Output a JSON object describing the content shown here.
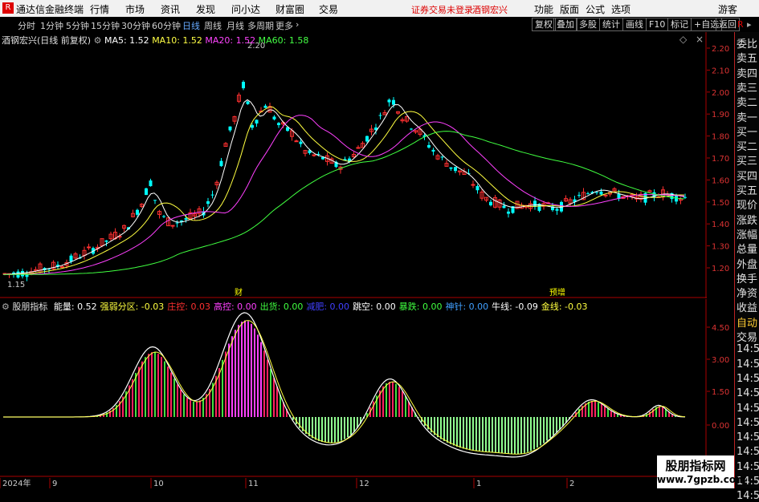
{
  "menubar": {
    "app_title": "通达信金融终端",
    "menus": [
      "行情",
      "市场",
      "资讯",
      "发现",
      "问小达",
      "财富圈",
      "交易"
    ],
    "notice": "证券交易未登录",
    "stock_name": "酒钢宏兴",
    "right_menus": [
      "功能",
      "版面",
      "公式",
      "选项"
    ],
    "guest": "游客"
  },
  "timeframes": [
    "分时",
    "1分钟",
    "5分钟",
    "15分钟",
    "30分钟",
    "60分钟",
    "日线",
    "周线",
    "月线",
    "多周期",
    "更多"
  ],
  "active_timeframe": "日线",
  "toolbar_buttons": [
    "复权",
    "叠加",
    "多股",
    "统计",
    "画线",
    "F10",
    "标记",
    "+自选",
    "返回"
  ],
  "main": {
    "title": "酒钢宏兴(日线 前复权)",
    "ma": [
      {
        "label": "MA5: 1.52",
        "color": "#ffffff"
      },
      {
        "label": "MA10: 1.52",
        "color": "#ffff40"
      },
      {
        "label": "MA20: 1.52",
        "color": "#ff40ff"
      },
      {
        "label": "MA60: 1.58",
        "color": "#40ff40"
      }
    ],
    "high_label": "2.20",
    "low_label": "1.15",
    "events": [
      "财",
      "预增"
    ],
    "price_ticks": [
      "2.20",
      "2.10",
      "2.00",
      "1.90",
      "1.80",
      "1.70",
      "1.60",
      "1.50",
      "1.40",
      "1.30",
      "1.20"
    ]
  },
  "sub": {
    "title": "股朋指标",
    "indicators": [
      {
        "label": "能量:",
        "value": "0.52",
        "color": "#ffffff"
      },
      {
        "label": "强弱分区:",
        "value": "-0.03",
        "color": "#ffff40"
      },
      {
        "label": "庄控:",
        "value": "0.03",
        "color": "#ff3030"
      },
      {
        "label": "高控:",
        "value": "0.00",
        "color": "#ff40ff"
      },
      {
        "label": "出货:",
        "value": "0.00",
        "color": "#40ff40"
      },
      {
        "label": "减肥:",
        "value": "0.00",
        "color": "#4040ff"
      },
      {
        "label": "跳空:",
        "value": "0.00",
        "color": "#ffffff"
      },
      {
        "label": "暴跌:",
        "value": "0.00",
        "color": "#40ff40"
      },
      {
        "label": "神针:",
        "value": "0.00",
        "color": "#40a0ff"
      },
      {
        "label": "牛线:",
        "value": "-0.09",
        "color": "#ffffff"
      },
      {
        "label": "金线:",
        "value": "-0.03",
        "color": "#ffff40"
      }
    ],
    "ticks": [
      "4.50",
      "3.00",
      "1.50",
      "0.00"
    ]
  },
  "right_panel": [
    "委比",
    "卖五",
    "卖四",
    "卖三",
    "卖二",
    "卖一",
    "买一",
    "买二",
    "买三",
    "买四",
    "买五",
    "现价",
    "涨跌",
    "涨幅",
    "总量",
    "外盘",
    "换手",
    "净资",
    "收益",
    "自动",
    "交易",
    "14:56",
    "14:56",
    "14:56",
    "14:56",
    "14:56",
    "14:56",
    "14:56",
    "14:56",
    "14:56",
    "14:56",
    "14:56"
  ],
  "xaxis": [
    "2024年",
    "9",
    "10",
    "11",
    "12",
    "1",
    "2"
  ],
  "watermark": {
    "line1": "股朋指标网",
    "line2": "www.7gpzb.com"
  },
  "colors": {
    "up": "#ff3030",
    "down": "#00ffff",
    "accent": "#d00000"
  }
}
